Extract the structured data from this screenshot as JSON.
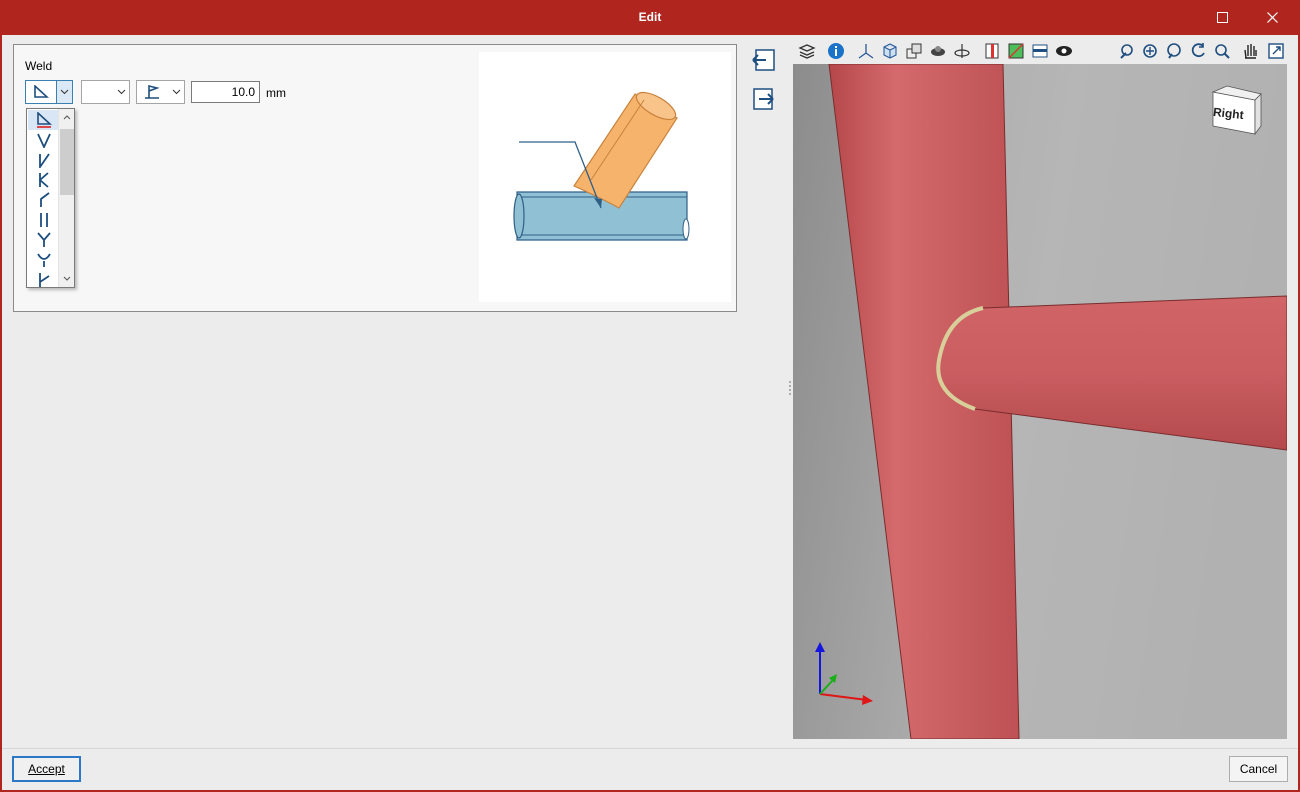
{
  "window": {
    "title": "Edit",
    "controls": {
      "maximize_icon": "maximize-icon",
      "close_icon": "close-icon"
    }
  },
  "weld": {
    "label": "Weld",
    "weld_type": {
      "selected": "fillet-weld-symbol",
      "expanded": true
    },
    "contour": {
      "selected": ""
    },
    "site_flag": {
      "selected": "field-weld-flag-symbol"
    },
    "size_value": "10.0",
    "size_unit": "mm",
    "dropdown_options": [
      "fillet-weld-symbol",
      "v-groove-symbol",
      "bevel-groove-symbol",
      "k-groove-symbol",
      "y-groove-symbol",
      "square-groove-symbol",
      "u-groove-symbol",
      "j-groove-symbol",
      "flare-bevel-symbol"
    ]
  },
  "side_buttons": [
    {
      "icon": "import-icon"
    },
    {
      "icon": "export-icon"
    }
  ],
  "viewer": {
    "toolbar_left": [
      "layers-icon",
      "info-icon",
      "axes-icon",
      "box-view-icon",
      "multi-view-icon",
      "visibility-icon",
      "rotate-axis-icon",
      "section-icon",
      "render-icon",
      "plane-icon",
      "eye-icon"
    ],
    "toolbar_right": [
      "undo-view-icon",
      "zoom-extents-icon",
      "zoom-window-icon",
      "rotate-icon",
      "zoom-icon",
      "pan-icon",
      "export-view-icon"
    ],
    "view_cube_label": "Right",
    "colors": {
      "member": "#c65a5c",
      "weld": "#d8cf9b",
      "background": "#9d9d9d"
    }
  },
  "footer": {
    "accept_label": "Accept",
    "cancel_label": "Cancel"
  }
}
